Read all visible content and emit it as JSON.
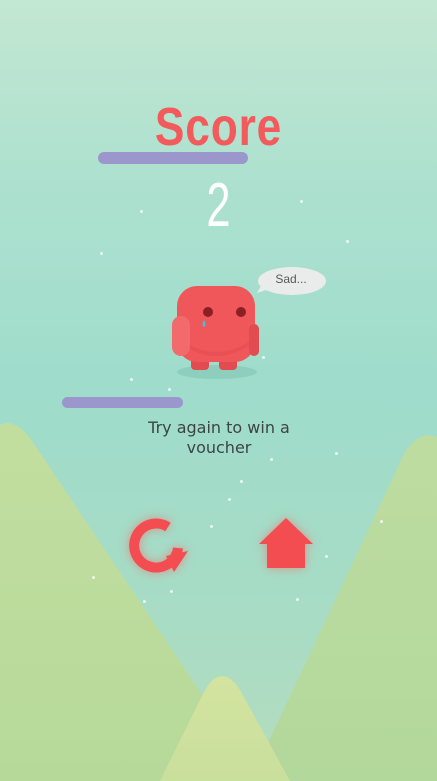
{
  "game": {
    "score_label": "Score",
    "score_value": "2",
    "speech_bubble": "Sad...",
    "message": "Try again to win a voucher"
  },
  "controls": {
    "retry_icon": "circular-arrow-icon",
    "home_icon": "home-icon"
  },
  "colors": {
    "accent": "#f25a5c",
    "bar": "#9b97cc",
    "background_top": "#c3e7d2",
    "background_mid": "#9fdccb",
    "hills": "#bfdd9e",
    "mascot": "#f0575a"
  }
}
